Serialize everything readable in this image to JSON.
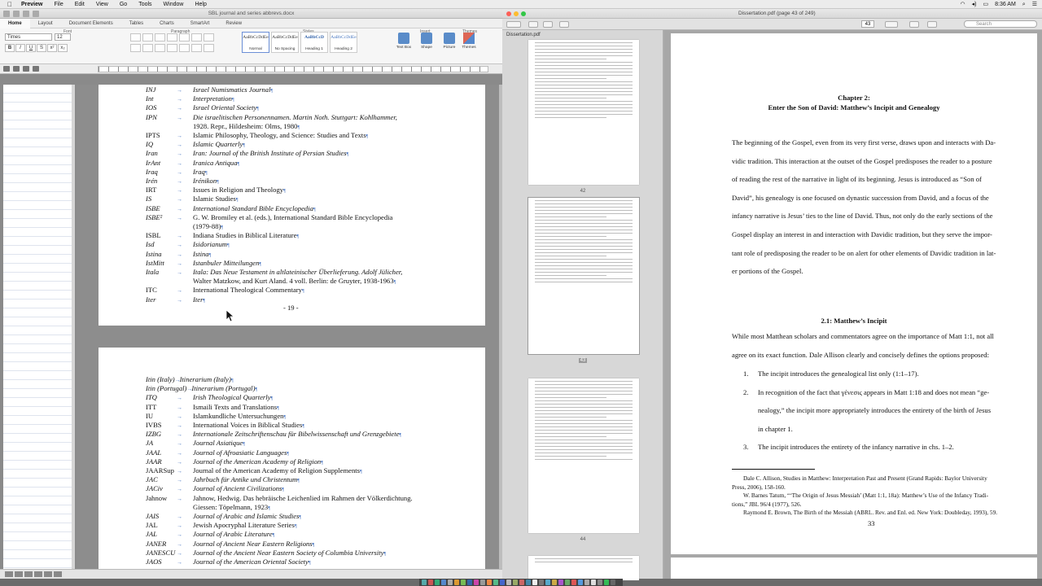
{
  "menubar": {
    "app": "Preview",
    "items": [
      "File",
      "Edit",
      "View",
      "Go",
      "Tools",
      "Window",
      "Help"
    ],
    "time": "8:36 AM"
  },
  "word": {
    "title": "SBL journal and series abbrevs.docx",
    "tabs": [
      "Home",
      "Layout",
      "Document Elements",
      "Tables",
      "Charts",
      "SmartArt",
      "Review"
    ],
    "font_name": "Times",
    "font_size": "12",
    "groups": {
      "font": "Font",
      "paragraph": "Paragraph",
      "styles": "Styles",
      "insert": "Insert",
      "themes": "Themes"
    },
    "styles": [
      {
        "sample": "AaBbCcDdEe",
        "name": "Normal"
      },
      {
        "sample": "AaBbCcDdEe",
        "name": "No Spacing"
      },
      {
        "sample": "AaBbCcD",
        "name": "Heading 1"
      },
      {
        "sample": "AaBbCcDdEe",
        "name": "Heading 2"
      }
    ],
    "insert_items": [
      "Text Box",
      "Shape",
      "Picture"
    ],
    "themes_label": "Themes",
    "page1_rows": [
      {
        "abb": "INJ",
        "desc": "Israel Numismatics Journal",
        "it": true,
        "abb_it": true
      },
      {
        "abb": "Int",
        "desc": "Interpretation",
        "it": true,
        "abb_it": true
      },
      {
        "abb": "IOS",
        "desc": "Israel Oriental Society",
        "it": true,
        "abb_it": true
      },
      {
        "abb": "IPN",
        "desc": "Die israelitischen Personennamen. Martin Noth. Stuttgart: Kohlhammer,",
        "it": true,
        "abb_it": true,
        "cont": "1928. Repr., Hildesheim: Olms, 1980"
      },
      {
        "abb": "IPTS",
        "desc": "Islamic Philosophy, Theology, and Science: Studies and Texts",
        "it": false,
        "abb_it": false
      },
      {
        "abb": "IQ",
        "desc": "Islamic Quarterly",
        "it": true,
        "abb_it": true
      },
      {
        "abb": "Iran",
        "desc": "Iran: Journal of the British Institute of Persian Studies",
        "it": true,
        "abb_it": true
      },
      {
        "abb": "IrAnt",
        "desc": "Iranica Antiqua",
        "it": true,
        "abb_it": true
      },
      {
        "abb": "Iraq",
        "desc": "Iraq",
        "it": true,
        "abb_it": true
      },
      {
        "abb": "Irén",
        "desc": "Irénikon",
        "it": true,
        "abb_it": true
      },
      {
        "abb": "IRT",
        "desc": "Issues in Religion and Theology",
        "it": false,
        "abb_it": false
      },
      {
        "abb": "IS",
        "desc": "Islamic Studies",
        "it": false,
        "abb_it": true
      },
      {
        "abb": "ISBE",
        "desc": "International Standard Bible Encyclopedia",
        "it": true,
        "abb_it": true
      },
      {
        "abb": "ISBE²",
        "desc": "G. W. Bromiley et al. (eds.), International Standard Bible Encyclopedia",
        "it": false,
        "abb_it": true,
        "cont": "(1979-88)"
      },
      {
        "abb": "ISBL",
        "desc": "Indiana Studies in Biblical Literature",
        "it": false,
        "abb_it": false
      },
      {
        "abb": "Isd",
        "desc": "Isidorianum",
        "it": true,
        "abb_it": true
      },
      {
        "abb": "Istina",
        "desc": "Istina",
        "it": true,
        "abb_it": true
      },
      {
        "abb": "IstMitt",
        "desc": "Istanbuler Mitteilungen",
        "it": true,
        "abb_it": true
      },
      {
        "abb": "Itala",
        "desc": "Itala: Das Neue Testament in altlateinischer Überlieferung. Adolf Jülicher,",
        "it": true,
        "abb_it": true,
        "cont": "Walter Matzkow, and Kurt Aland. 4 voll. Berlin: de Gruyter, 1938-1963"
      },
      {
        "abb": "ITC",
        "desc": "International Theological Commentary",
        "it": false,
        "abb_it": false
      },
      {
        "abb": "Iter",
        "desc": "Iter",
        "it": true,
        "abb_it": true
      }
    ],
    "page1_number": "- 19 -",
    "page2_rows": [
      {
        "abb": "Itin (Italy)",
        "desc": "Itinerarium (Italy)",
        "it": true,
        "abb_it": true
      },
      {
        "abb": "Itin (Portugal)",
        "desc": "Itinerarium (Portugal)",
        "it": true,
        "abb_it": true
      },
      {
        "abb": "ITQ",
        "desc": "Irish Theological Quarterly",
        "it": true,
        "abb_it": true
      },
      {
        "abb": "ITT",
        "desc": "Ismaili Texts and Translations",
        "it": false,
        "abb_it": false
      },
      {
        "abb": "IU",
        "desc": "Islamkundliche Untersuchungen",
        "it": false,
        "abb_it": false
      },
      {
        "abb": "IVBS",
        "desc": "International Voices in Biblical Studies",
        "it": false,
        "abb_it": false
      },
      {
        "abb": "IZBG",
        "desc": "Internationale Zeitschriftenschau für Bibelwissenschaft und Grenzgebiete",
        "it": true,
        "abb_it": true
      },
      {
        "abb": "JA",
        "desc": "Journal Asiatique",
        "it": true,
        "abb_it": true
      },
      {
        "abb": "JAAL",
        "desc": "Journal of Afroasiatic Languages",
        "it": true,
        "abb_it": true
      },
      {
        "abb": "JAAR",
        "desc": "Journal of the American Academy of Religion",
        "it": true,
        "abb_it": true
      },
      {
        "abb": "JAARSup",
        "desc": "Journal of the American Academy of Religion Supplements",
        "it": false,
        "abb_it": false
      },
      {
        "abb": "JAC",
        "desc": "Jahrbuch für Antike und Christentum",
        "it": true,
        "abb_it": true
      },
      {
        "abb": "JACiv",
        "desc": "Journal of Ancient Civilizations",
        "it": true,
        "abb_it": true
      },
      {
        "abb": "Jahnow",
        "desc": "Jahnow, Hedwig. Das hebräische Leichenlied im Rahmen der Völkerdichtung.",
        "it": false,
        "abb_it": false,
        "cont": "Giessen: Töpelmann, 1923"
      },
      {
        "abb": "JAIS",
        "desc": "Journal of Arabic and Islamic Studies",
        "it": true,
        "abb_it": true
      },
      {
        "abb": "JAL",
        "desc": "Jewish Apocryphal Literature Series",
        "it": false,
        "abb_it": false
      },
      {
        "abb": "JAL",
        "desc": "Journal of Arabic Literature",
        "it": true,
        "abb_it": true
      },
      {
        "abb": "JANER",
        "desc": "Journal of Ancient Near Eastern Religions",
        "it": true,
        "abb_it": true
      },
      {
        "abb": "JANESCU",
        "desc": "Journal of the Ancient Near Eastern Society of Columbia University",
        "it": true,
        "abb_it": true
      },
      {
        "abb": "JAOS",
        "desc": "Journal of the American Oriental Society",
        "it": true,
        "abb_it": true
      }
    ]
  },
  "preview": {
    "title": "Dissertation.pdf (page 43 of 249)",
    "sidebar_file": "Dissertation.pdf",
    "page_field": "43",
    "search_placeholder": "Search",
    "thumb_numbers": [
      "42",
      "43",
      "44"
    ],
    "chapter_line1": "Chapter 2:",
    "chapter_line2": "Enter the Son of David: Matthew’s Incipit and Genealogy",
    "para1": [
      "The beginning of the Gospel, even from its very first verse, draws upon and interacts with Da-",
      "vidic tradition. This interaction at the outset of the Gospel predisposes the reader to a posture",
      "of reading the rest of the narrative in light of its beginning. Jesus is introduced as “Son of",
      "David”, his genealogy is one focused on dynastic succession from David, and a focus of the",
      "infancy narrative is Jesus’ ties to the line of David. Thus, not only do the early sections of the",
      "Gospel display an interest in and interaction with Davidic tradition, but they serve the impor-",
      "tant role of predisposing the reader to be on alert for other elements of Davidic tradition in lat-",
      "er portions of the Gospel."
    ],
    "section_heading": "2.1: Matthew’s Incipit",
    "para2": [
      "While most Matthean scholars and commentators agree on the importance of Matt 1:1, not all",
      "agree on its exact function. Dale Allison clearly and concisely defines the options proposed:"
    ],
    "list": [
      {
        "n": "1.",
        "lines": [
          "The incipit introduces the genealogical list only (1:1–17)."
        ]
      },
      {
        "n": "2.",
        "lines": [
          "In recognition of the fact that γένεσις appears in Matt 1:18 and does not mean “ge-",
          "nealogy,” the incipit more appropriately introduces the entirety of the birth of Jesus",
          "in chapter 1."
        ]
      },
      {
        "n": "3.",
        "lines": [
          "The incipit introduces the entirety of the infancy narrative in chs. 1–2."
        ]
      }
    ],
    "footnotes": [
      "Dale C. Allison, Studies in Matthew: Interpretation Past and Present (Grand Rapids: Baylor University",
      "Press, 2006), 158-160.",
      "W. Barnes Tatum, “‘The Origin of Jesus Messiah’ (Matt 1:1, 18a): Matthew’s Use of the Infancy Tradi-",
      "tions,” JBL 96/4 (1977), 526.",
      "Raymond E. Brown, The Birth of the Messiah (ABRL. Rev. and Enl. ed. New York: Doubleday, 1993), 59."
    ],
    "page_number": "33"
  }
}
